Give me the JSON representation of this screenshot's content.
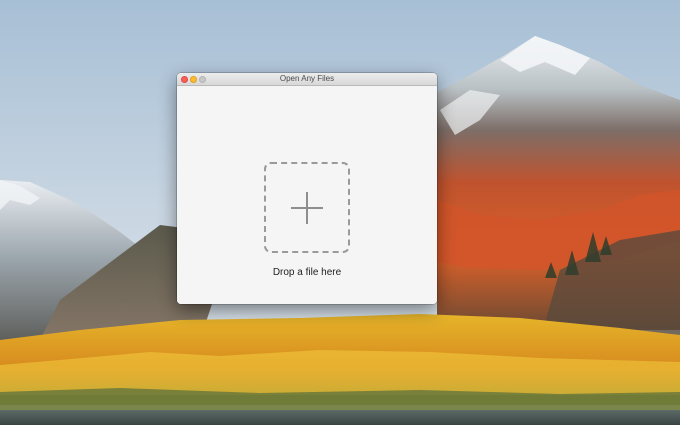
{
  "window": {
    "title": "Open Any Files"
  },
  "drop_zone": {
    "label": "Drop a file here",
    "icon": "plus-icon"
  }
}
